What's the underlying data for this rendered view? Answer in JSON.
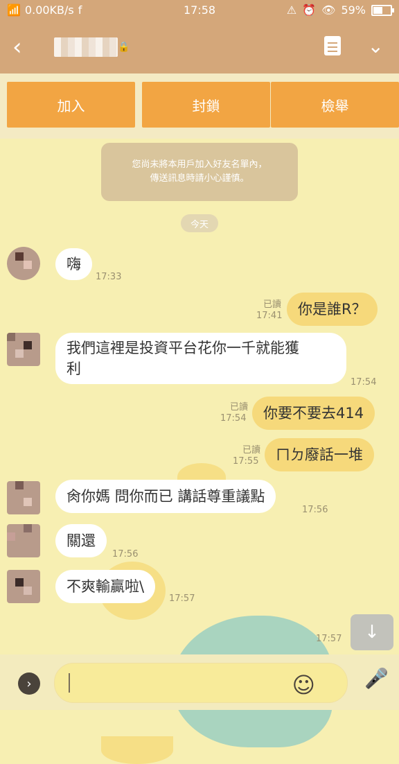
{
  "status": {
    "network_speed": "0.00KB/s",
    "time": "17:58",
    "battery": "59%",
    "battery_level": 0.59
  },
  "header": {
    "back_icon": "‹",
    "lock_icon": "🔒",
    "menu_icon": "list-icon",
    "down_icon": "⌄"
  },
  "actions": {
    "add": "加入",
    "block": "封鎖",
    "report": "檢舉"
  },
  "notice": {
    "line1": "您尚未將本用戶加入好友名單內，",
    "line2": "傳送訊息時請小心謹慎。"
  },
  "date_label": "今天",
  "messages": [
    {
      "side": "in",
      "text": "嗨",
      "time": "17:33"
    },
    {
      "side": "out",
      "text": "你是誰R？",
      "read": "已讀",
      "time": "17:41"
    },
    {
      "side": "in",
      "text_line1": "我們這裡是投資平台花你一千就能獲",
      "text_line2": "利",
      "time": "17:54"
    },
    {
      "side": "out",
      "text": "你要不要去414",
      "read": "已讀",
      "time": "17:54"
    },
    {
      "side": "out",
      "text": "ㄇㄉ廢話一堆",
      "read": "已讀",
      "time": "17:55"
    },
    {
      "side": "in",
      "text": "肏你媽 問你而已 講話尊重議點",
      "time": "17:56"
    },
    {
      "side": "in",
      "text": "關還",
      "time": "17:56"
    },
    {
      "side": "in",
      "text": "不爽輸贏啦\\",
      "time": "17:57"
    }
  ],
  "last_time": "17:57",
  "scroll_icon": "↓",
  "input": {
    "placeholder": ""
  },
  "icons": {
    "plus": "›",
    "emoji": "☺",
    "mic": "🎤"
  },
  "colors": {
    "header": "#d4a77a",
    "chat_bg": "#f7efb2",
    "action_button": "#f2a543",
    "outgoing_bubble": "#f6d97b"
  }
}
